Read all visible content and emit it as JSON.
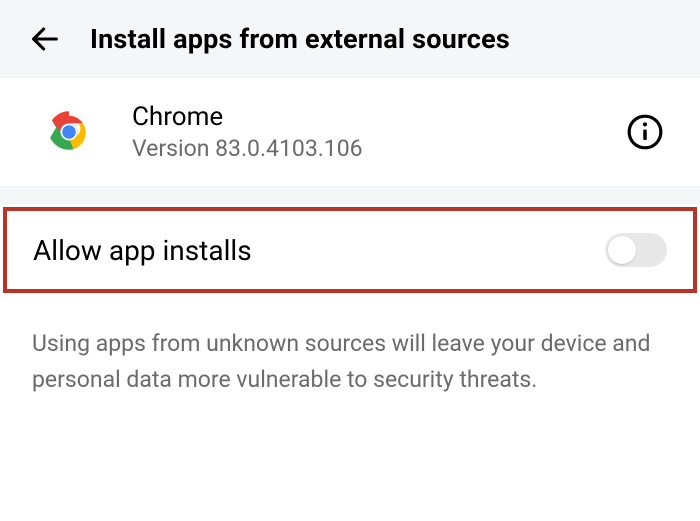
{
  "header": {
    "title": "Install apps from external sources"
  },
  "app": {
    "name": "Chrome",
    "version": "Version 83.0.4103.106"
  },
  "toggle": {
    "label": "Allow app installs",
    "state": "off"
  },
  "warning": "Using apps from unknown sources will leave your device and personal data more vulnerable to security threats."
}
